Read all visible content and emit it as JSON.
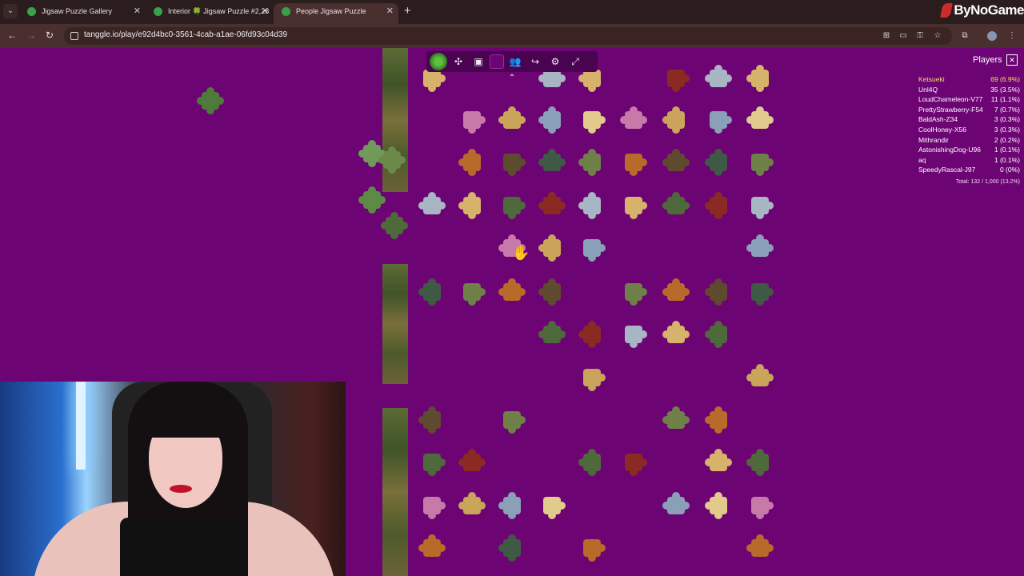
{
  "browser": {
    "tabs": [
      {
        "label": "Jigsaw Puzzle Gallery",
        "active": false
      },
      {
        "label": "Interior 🍀 Jigsaw Puzzle #2,28",
        "active": false
      },
      {
        "label": "People Jigsaw Puzzle",
        "active": true
      }
    ],
    "new_tab": "+",
    "url": "tanggle.io/play/e92d4bc0-3561-4cab-a1ae-06fd93c04d39",
    "brand": "ByNoGame"
  },
  "puzzle_toolbar": {
    "icons": [
      "tanggle-logo-icon",
      "puzzle-piece-icon",
      "image-preview-icon",
      "background-color-icon",
      "players-icon",
      "share-icon",
      "settings-icon",
      "fullscreen-icon"
    ],
    "background_color": "#6d0474",
    "collapse": "⌃"
  },
  "players_panel": {
    "title": "Players",
    "players": [
      {
        "name": "Ketsueki",
        "score": "69 (6.9%)"
      },
      {
        "name": "Unl4Q",
        "score": "35 (3.5%)"
      },
      {
        "name": "LoudChameleon-V77",
        "score": "11 (1.1%)"
      },
      {
        "name": "PrettyStrawberry-F54",
        "score": "7 (0.7%)"
      },
      {
        "name": "BaldAsh-Z34",
        "score": "3 (0.3%)"
      },
      {
        "name": "CoolHoney-X56",
        "score": "3 (0.3%)"
      },
      {
        "name": "Mithrandir",
        "score": "2 (0.2%)"
      },
      {
        "name": "AstonishingDog-U96",
        "score": "1 (0.1%)"
      },
      {
        "name": "aq",
        "score": "1 (0.1%)"
      },
      {
        "name": "SpeedyRascal-J97",
        "score": "0 (0%)"
      }
    ],
    "total": "Total: 132 / 1,000 (13.2%)",
    "leader_color": "#f2e05a"
  },
  "colors": {
    "canvas": "#6d0474",
    "browser_chrome": "#4a2f2f"
  }
}
